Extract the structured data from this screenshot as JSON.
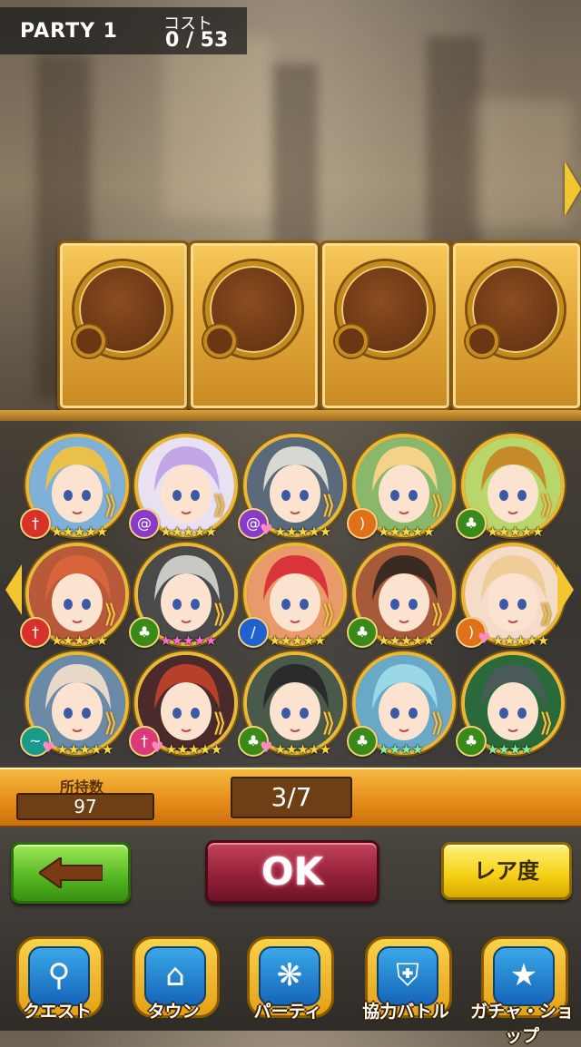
{
  "header": {
    "party_title": "PARTY 1",
    "cost_label": "コスト",
    "cost_value": "0 / 53"
  },
  "party_slots": [
    {
      "state": "empty"
    },
    {
      "state": "empty"
    },
    {
      "state": "empty"
    },
    {
      "state": "empty"
    }
  ],
  "characters": [
    {
      "name_icon": "portrait-blonde-boy",
      "element": "red",
      "element_icon": "sword-icon",
      "stars": 5,
      "star_color": "#f7d94a",
      "hair": "#e8c04a",
      "bg": "#7fb0d8",
      "heart": false
    },
    {
      "name_icon": "portrait-lavender-girl",
      "element": "purple",
      "element_icon": "swirl-icon",
      "stars": 5,
      "star_color": "#f7d94a",
      "hair": "#c2a6e6",
      "bg": "#e9e0f2",
      "heart": false
    },
    {
      "name_icon": "portrait-silver-girl",
      "element": "purple",
      "element_icon": "swirl-icon",
      "stars": 5,
      "star_color": "#f7d94a",
      "hair": "#d8d8d2",
      "bg": "#5a6a7a",
      "heart": true
    },
    {
      "name_icon": "portrait-flower-girl",
      "element": "orange",
      "element_icon": "bow-icon",
      "stars": 5,
      "star_color": "#f7d94a",
      "hair": "#f5d28a",
      "bg": "#8ab86a",
      "heart": false
    },
    {
      "name_icon": "portrait-bob-girl",
      "element": "green",
      "element_icon": "leaf-icon",
      "stars": 5,
      "star_color": "#f7d94a",
      "hair": "#c68a2a",
      "bg": "#b8d66a",
      "heart": false
    },
    {
      "name_icon": "portrait-fox-girl",
      "element": "red",
      "element_icon": "sword-icon",
      "stars": 5,
      "star_color": "#f7d94a",
      "hair": "#d8643a",
      "bg": "#b85a3a",
      "heart": false
    },
    {
      "name_icon": "portrait-wolf-boy",
      "element": "green",
      "element_icon": "leaf-icon",
      "stars": 5,
      "star_color": "#ff6ad0",
      "hair": "#c8c8c4",
      "bg": "#4a4a4a",
      "heart": false
    },
    {
      "name_icon": "portrait-red-boy",
      "element": "blue",
      "element_icon": "wand-icon",
      "stars": 5,
      "star_color": "#f7d94a",
      "hair": "#d8343a",
      "bg": "#e89a6a",
      "heart": false
    },
    {
      "name_icon": "portrait-oni-boy",
      "element": "green",
      "element_icon": "leaf-icon",
      "stars": 5,
      "star_color": "#f7d94a",
      "hair": "#3a2a22",
      "bg": "#a65a3a",
      "heart": false
    },
    {
      "name_icon": "portrait-ribbon-girl",
      "element": "orange",
      "element_icon": "bow-icon",
      "stars": 5,
      "star_color": "#f7d94a",
      "hair": "#f0cc98",
      "bg": "#f4dcc8",
      "heart": true
    },
    {
      "name_icon": "portrait-pale-boy",
      "element": "teal",
      "element_icon": "wind-icon",
      "stars": 5,
      "star_color": "#f7d94a",
      "hair": "#e8d8c8",
      "bg": "#6a8aa8",
      "heart": true
    },
    {
      "name_icon": "portrait-crimson-boy",
      "element": "pink",
      "element_icon": "sword-icon",
      "stars": 5,
      "star_color": "#f7d94a",
      "hair": "#b8402a",
      "bg": "#4a2a2a",
      "heart": true
    },
    {
      "name_icon": "portrait-hooded-man",
      "element": "green",
      "element_icon": "leaf-icon",
      "stars": 5,
      "star_color": "#f7d94a",
      "hair": "#2a2a2a",
      "bg": "#4a5a4a",
      "heart": true
    },
    {
      "name_icon": "portrait-ice-spirit",
      "element": "green",
      "element_icon": "leaf-icon",
      "stars": 4,
      "star_color": "#8af0a0",
      "hair": "#9ad8e8",
      "bg": "#6aa8c8",
      "heart": false
    },
    {
      "name_icon": "portrait-wolf-beast",
      "element": "green",
      "element_icon": "leaf-icon",
      "stars": 4,
      "star_color": "#8af0a0",
      "hair": "#4a5a58",
      "bg": "#2a6a3a",
      "heart": false
    }
  ],
  "element_colors": {
    "red": "#d8312a",
    "purple": "#8a3ac8",
    "orange": "#e0701a",
    "green": "#3a8a1a",
    "blue": "#2060d0",
    "teal": "#1a9a8a",
    "pink": "#d83a7a"
  },
  "counter": {
    "owned_label": "所持数",
    "owned_value": "97",
    "page": "3/7"
  },
  "buttons": {
    "back_icon": "arrow-left-icon",
    "ok_label": "OK",
    "rarity_label": "レア度"
  },
  "nav": [
    {
      "label": "クエスト",
      "icon": "quest-map-icon",
      "glyph": "⚲"
    },
    {
      "label": "タウン",
      "icon": "town-treasure-icon",
      "glyph": "⌂"
    },
    {
      "label": "パーティ",
      "icon": "party-people-icon",
      "glyph": "❋"
    },
    {
      "label": "協力バトル",
      "icon": "coop-shield-icon",
      "glyph": "⛨"
    },
    {
      "label": "ガチャ・ショップ",
      "icon": "gacha-star-icon",
      "glyph": "★"
    }
  ]
}
